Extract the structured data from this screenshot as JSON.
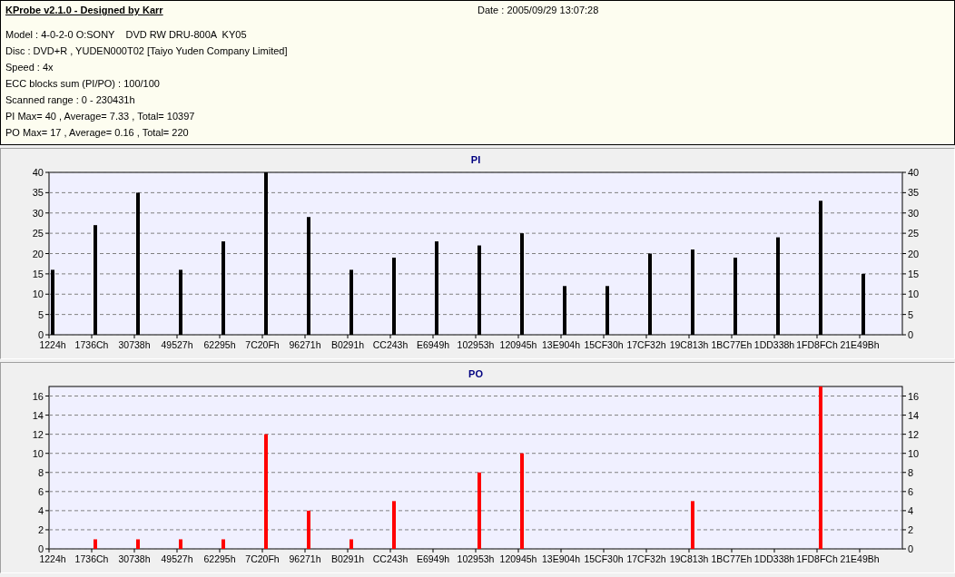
{
  "header": {
    "title": "KProbe v2.1.0 - Designed by Karr",
    "date": "Date : 2005/09/29 13:07:28",
    "lines": [
      "Model : 4-0-2-0 O:SONY    DVD RW DRU-800A  KY05",
      "Disc : DVD+R , YUDEN000T02 [Taiyo Yuden Company Limited]",
      "Speed : 4x",
      "ECC blocks sum (PI/PO) : 100/100",
      "Scanned range : 0 - 230431h",
      "PI Max= 40 , Average= 7.33 , Total= 10397",
      "PO Max= 17 , Average= 0.16 , Total= 220"
    ]
  },
  "charts": [
    {
      "right_axis_labels": [
        "40",
        "35",
        "30",
        "25",
        "20",
        "15",
        "10",
        "5",
        "0"
      ],
      "chart_data": {
        "type": "bar",
        "title": "PI",
        "grid": true,
        "ylim": [
          0,
          40
        ],
        "yticks": [
          0,
          5,
          10,
          15,
          20,
          25,
          30,
          35,
          40
        ],
        "categories": [
          "1224h",
          "1736Ch",
          "30738h",
          "49527h",
          "62295h",
          "7C20Fh",
          "96271h",
          "B0291h",
          "CC243h",
          "E6949h",
          "102953h",
          "120945h",
          "13E904h",
          "15CF30h",
          "17CF32h",
          "19C813h",
          "1BC77Eh",
          "1DD338h",
          "1FD8FCh",
          "21E49Bh"
        ],
        "series": [
          {
            "color": "#000000",
            "values": [
              16,
              27,
              35,
              16,
              23,
              40,
              29,
              16,
              19,
              23,
              22,
              25,
              12,
              12,
              20,
              21,
              19,
              24,
              33,
              15
            ]
          }
        ]
      }
    },
    {
      "right_axis_labels": [
        "16",
        "14",
        "12",
        "10",
        "8",
        "6",
        "4",
        "2",
        "0"
      ],
      "chart_data": {
        "type": "bar",
        "title": "PO",
        "grid": true,
        "ylim": [
          0,
          17
        ],
        "yticks": [
          0,
          2,
          4,
          6,
          8,
          10,
          12,
          14,
          16
        ],
        "categories": [
          "1224h",
          "1736Ch",
          "30738h",
          "49527h",
          "62295h",
          "7C20Fh",
          "96271h",
          "B0291h",
          "CC243h",
          "E6949h",
          "102953h",
          "120945h",
          "13E904h",
          "15CF30h",
          "17CF32h",
          "19C813h",
          "1BC77Eh",
          "1DD338h",
          "1FD8FCh",
          "21E49Bh"
        ],
        "series": [
          {
            "color": "#ff0000",
            "values": [
              0,
              1,
              1,
              1,
              1,
              12,
              4,
              1,
              5,
              0,
              8,
              10,
              0,
              0,
              0,
              5,
              0,
              0,
              17,
              0
            ]
          }
        ]
      }
    }
  ]
}
